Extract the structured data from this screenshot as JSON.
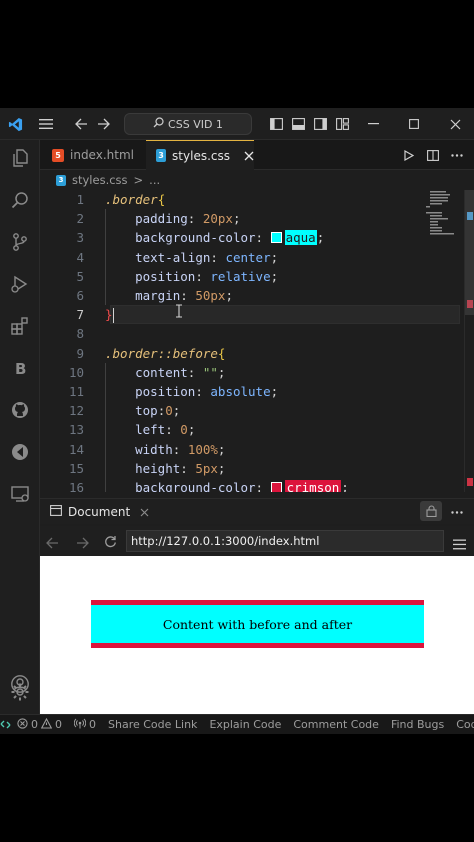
{
  "titlebar": {
    "search_text": "CSS VID 1"
  },
  "tabs": [
    {
      "label": "index.html"
    },
    {
      "label": "styles.css"
    }
  ],
  "breadcrumb": {
    "file": "styles.css",
    "sep": ">",
    "more": "..."
  },
  "editor": {
    "current_line": 7,
    "lines": [
      {
        "n": "1"
      },
      {
        "n": "2"
      },
      {
        "n": "3"
      },
      {
        "n": "4"
      },
      {
        "n": "5"
      },
      {
        "n": "6"
      },
      {
        "n": "7"
      },
      {
        "n": "8"
      },
      {
        "n": "9"
      },
      {
        "n": "10"
      },
      {
        "n": "11"
      },
      {
        "n": "12"
      },
      {
        "n": "13"
      },
      {
        "n": "14"
      },
      {
        "n": "15"
      },
      {
        "n": "16"
      }
    ],
    "code": {
      "l1_sel": ".border",
      "l1_brace": "{",
      "l2_prop": "padding",
      "l2_val": "20px",
      "l3_prop": "background-color",
      "l3_val": "aqua",
      "l4_prop": "text-align",
      "l4_val": "center",
      "l5_prop": "position",
      "l5_val": "relative",
      "l6_prop": "margin",
      "l6_val": "50px",
      "l7_brace": "}",
      "l9_sel": ".border",
      "l9_pseudo": "::before",
      "l9_brace": "{",
      "l10_prop": "content",
      "l10_val": "\"\"",
      "l11_prop": "position",
      "l11_val": "absolute",
      "l12_prop": "top",
      "l12_val": "0",
      "l13_prop": "left",
      "l13_val": "0",
      "l14_prop": "width",
      "l14_val": "100%",
      "l15_prop": "height",
      "l15_val": "5px",
      "l16_prop": "background-color",
      "l16_val": "crimson"
    },
    "colors": {
      "aqua": "#00ffff",
      "crimson": "#dc143c"
    }
  },
  "panel": {
    "tab_label": "Document",
    "url": "http://127.0.0.1:3000/index.html"
  },
  "preview": {
    "text": "Content with before and after"
  },
  "statusbar": {
    "errors": "0",
    "warnings": "0",
    "ports": "0",
    "items": [
      "Share Code Link",
      "Explain Code",
      "Comment Code",
      "Find Bugs",
      "Code Chat"
    ]
  }
}
